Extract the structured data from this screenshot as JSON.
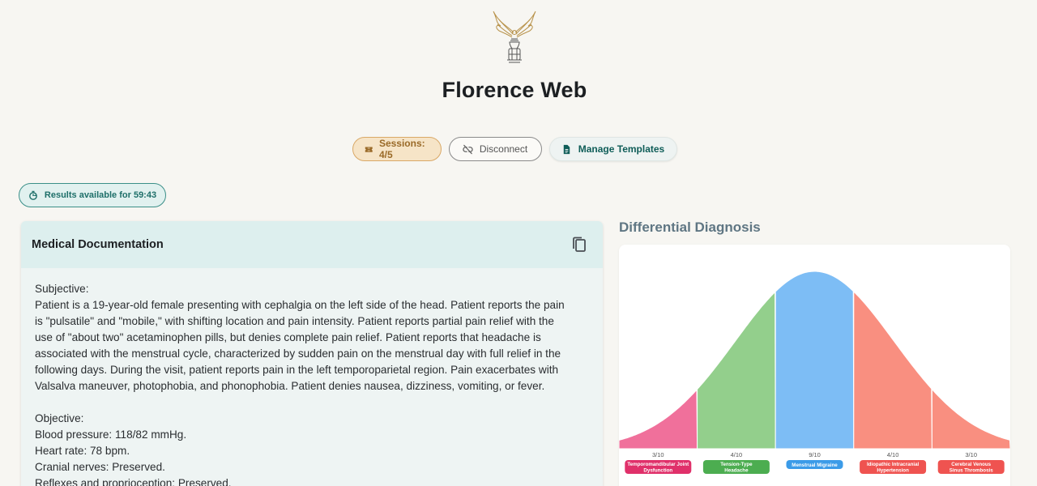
{
  "app": {
    "title": "Florence Web"
  },
  "toolbar": {
    "sessions_label": "Sessions: 4/5",
    "disconnect_label": "Disconnect",
    "templates_label": "Manage Templates"
  },
  "timer": {
    "label": "Results available for 59:43"
  },
  "documentation": {
    "title": "Medical Documentation",
    "subjective_heading": "Subjective:",
    "subjective_lines": [
      "Patient is a 19-year-old female presenting with cephalgia on the left side of the head. Patient reports the pain",
      "is \"pulsatile\" and \"mobile,\" with shifting location and pain intensity. Patient reports partial pain relief with the",
      "use of \"about two\" acetaminophen pills, but denies complete pain relief. Patient reports that headache is",
      "associated with the menstrual cycle, characterized by sudden pain on the menstrual day with full relief in the",
      "following days. During the visit, patient reports pain in the left temporoparietal region. Pain exacerbates with",
      "Valsalva maneuver, photophobia, and phonophobia. Patient denies nausea, dizziness, vomiting, or fever."
    ],
    "objective_heading": "Objective:",
    "objective_lines": [
      "Blood pressure: 118/82 mmHg.",
      "Heart rate: 78 bpm.",
      "Cranial nerves: Preserved.",
      "Reflexes and proprioception: Preserved."
    ]
  },
  "differential": {
    "title": "Differential Diagnosis"
  },
  "chart_data": {
    "type": "area",
    "categories": [
      "Temporomandibular Joint Dysfunction",
      "Tension-Type Headache",
      "Menstrual Migraine",
      "Idiopathic Intracranial Hypertension",
      "Cerebral Venous Sinus Thrombosis"
    ],
    "values": [
      3,
      4,
      9,
      4,
      3
    ],
    "value_labels": [
      "3/10",
      "4/10",
      "9/10",
      "4/10",
      "3/10"
    ],
    "max": 10,
    "colors": [
      "#f0709b",
      "#93cf8c",
      "#7dbdf5",
      "#f98f80",
      "#f98f80"
    ],
    "label_colors": [
      "#e0306a",
      "#4cad50",
      "#3b9be8",
      "#ef5350",
      "#ef5350"
    ]
  }
}
